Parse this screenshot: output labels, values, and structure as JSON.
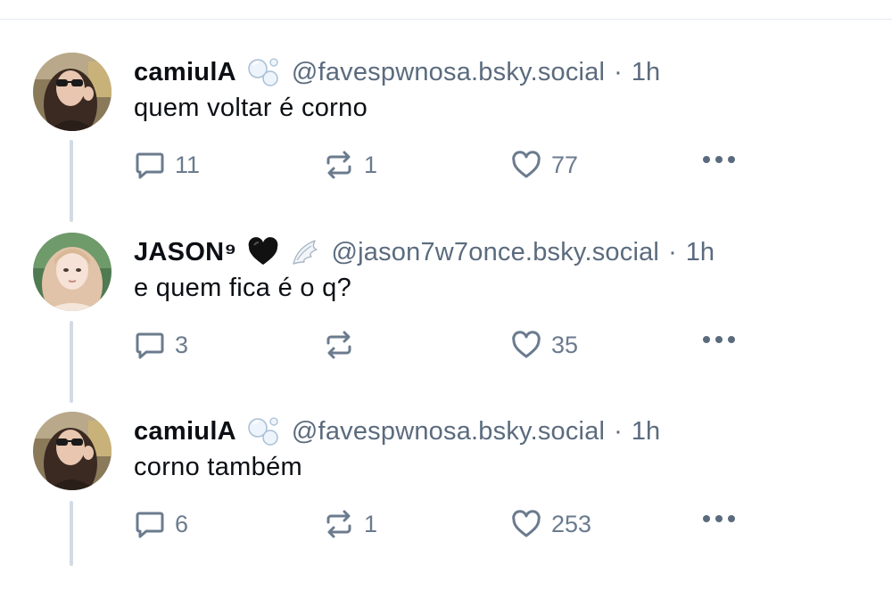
{
  "posts": [
    {
      "author_name": "camiulA",
      "author_emoji": "bubbles-icon",
      "handle": "@favespwnosa.bsky.social",
      "separator": "·",
      "time": "1h",
      "text": "quem voltar é corno",
      "replies": "11",
      "reposts": "1",
      "likes": "77"
    },
    {
      "author_name": "JASON⁹",
      "author_emoji": "black-heart-icon, wing-icon",
      "handle": "@jason7w7once.bsky.social",
      "separator": "·",
      "time": "1h",
      "text": "e quem fica é o q?",
      "replies": "3",
      "reposts": "",
      "likes": "35"
    },
    {
      "author_name": "camiulA",
      "author_emoji": "bubbles-icon",
      "handle": "@favespwnosa.bsky.social",
      "separator": "·",
      "time": "1h",
      "text": "corno também",
      "replies": "6",
      "reposts": "1",
      "likes": "253"
    }
  ],
  "colors": {
    "text": "#0b0f14",
    "muted": "#5b6b7e",
    "thread_line": "#d2dae3"
  }
}
